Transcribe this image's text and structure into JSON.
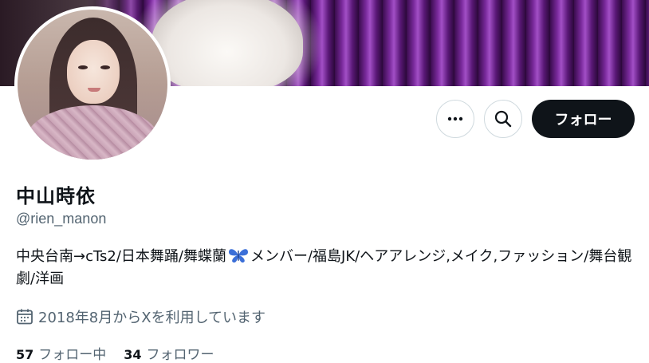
{
  "profile": {
    "display_name": "中山時依",
    "handle": "@rien_manon",
    "bio_before_emoji": "中央台南→cTs2/日本舞踊/舞蝶蘭",
    "bio_emoji_icon": "butterfly-emoji",
    "bio_after_emoji": "メンバー/福島JK/ヘアアレンジ,メイク,ファッション/舞台観劇/洋画",
    "joined_text": "2018年8月からXを利用しています"
  },
  "actions": {
    "more_icon": "more-icon",
    "search_icon": "search-icon",
    "follow_label": "フォロー"
  },
  "stats": {
    "following_count": "57",
    "following_label": "フォロー中",
    "followers_count": "34",
    "followers_label": "フォロワー"
  },
  "colors": {
    "text_primary": "#0f1419",
    "text_secondary": "#536471",
    "follow_button_bg": "#0f1419",
    "border": "#cfd9de"
  }
}
